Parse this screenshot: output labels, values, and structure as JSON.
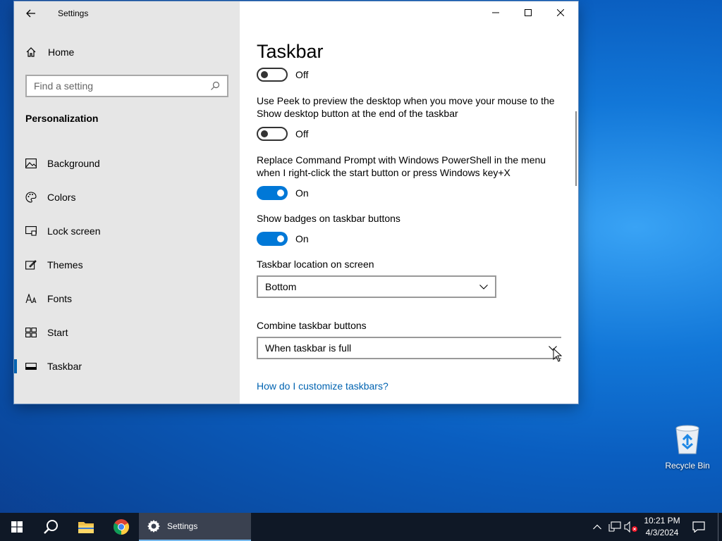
{
  "window": {
    "app_title": "Settings",
    "sidebar": {
      "home_label": "Home",
      "search_placeholder": "Find a setting",
      "section_heading": "Personalization",
      "items": [
        {
          "label": "Background",
          "icon": "picture-icon"
        },
        {
          "label": "Colors",
          "icon": "palette-icon"
        },
        {
          "label": "Lock screen",
          "icon": "lock-screen-icon"
        },
        {
          "label": "Themes",
          "icon": "themes-icon"
        },
        {
          "label": "Fonts",
          "icon": "fonts-icon"
        },
        {
          "label": "Start",
          "icon": "start-icon"
        },
        {
          "label": "Taskbar",
          "icon": "taskbar-icon",
          "active": true
        }
      ]
    },
    "content": {
      "title": "Taskbar",
      "toggle_top_state": "Off",
      "peek_desc": "Use Peek to preview the desktop when you move your mouse to the Show desktop button at the end of the taskbar",
      "peek_state": "Off",
      "powershell_desc": "Replace Command Prompt with Windows PowerShell in the menu when I right-click the start button or press Windows key+X",
      "powershell_state": "On",
      "badges_desc": "Show badges on taskbar buttons",
      "badges_state": "On",
      "location_label": "Taskbar location on screen",
      "location_value": "Bottom",
      "combine_label": "Combine taskbar buttons",
      "combine_value": "When taskbar is full",
      "help_link": "How do I customize taskbars?"
    }
  },
  "desktop": {
    "recycle_bin_label": "Recycle Bin"
  },
  "taskbar": {
    "active_app_label": "Settings",
    "time": "10:21 PM",
    "date": "4/3/2024"
  },
  "colors": {
    "accent": "#0078d7",
    "link": "#0063b1",
    "sidebar_bg": "#e6e6e6",
    "taskbar_bg": "#0f1826"
  }
}
